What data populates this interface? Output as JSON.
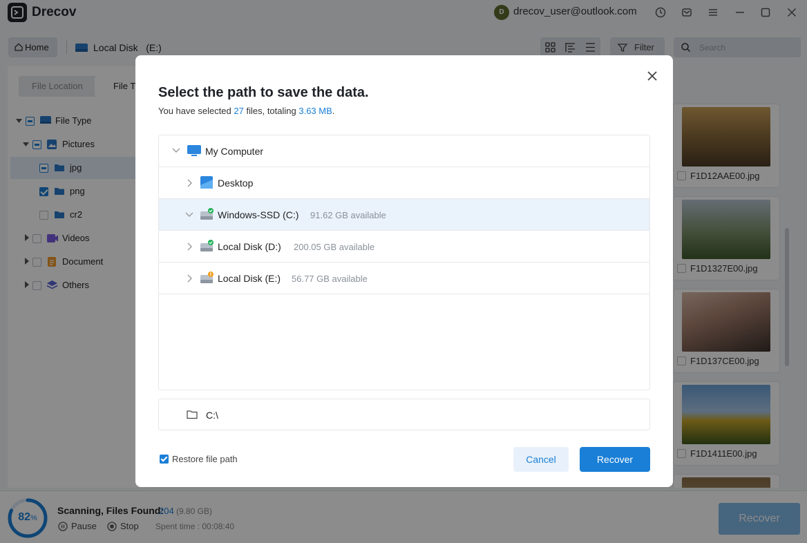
{
  "app": {
    "name": "Drecov",
    "user_email": "drecov_user@outlook.com",
    "avatar_initial": "D"
  },
  "toolbar": {
    "home_label": "Home",
    "location": "Local Disk   (E:)",
    "filter_label": "Filter",
    "search_placeholder": "Search"
  },
  "left_panel": {
    "tabs": [
      {
        "label": "File Location"
      },
      {
        "label": "File Type"
      }
    ],
    "tree": [
      {
        "label": "File Type",
        "state": "partial"
      },
      {
        "label": "Pictures",
        "state": "partial"
      },
      {
        "label": "jpg",
        "state": "partial"
      },
      {
        "label": "png",
        "state": "checked"
      },
      {
        "label": "cr2",
        "state": "unchecked"
      },
      {
        "label": "Videos",
        "state": "unchecked"
      },
      {
        "label": "Document",
        "state": "unchecked"
      },
      {
        "label": "Others",
        "state": "unchecked"
      }
    ]
  },
  "thumbnails": [
    {
      "name": "F1D12AAE00.jpg"
    },
    {
      "name": "F1D1327E00.jpg"
    },
    {
      "name": "F1D137CE00.jpg"
    },
    {
      "name": "F1D1411E00.jpg"
    }
  ],
  "scan": {
    "progress": 82,
    "progress_text": "82",
    "progress_unit": "%",
    "title": "Scanning, Files Found:",
    "count": "204",
    "size": "(9.80 GB)",
    "pause_label": "Pause",
    "stop_label": "Stop",
    "spent_time": "Spent time : 00:08:40",
    "recover_label": "Recover"
  },
  "dialog": {
    "title": "Select the path to save the data.",
    "sub_prefix": "You have selected ",
    "sub_files": "27",
    "sub_middle": " files, totaling ",
    "sub_size": "3.63 MB",
    "sub_suffix": ".",
    "tree": {
      "root": "My Computer",
      "items": [
        {
          "name": "Desktop",
          "available": ""
        },
        {
          "name": "Windows-SSD (C:)",
          "available": "91.62 GB available"
        },
        {
          "name": "Local Disk (D:)",
          "available": "200.05 GB available"
        },
        {
          "name": "Local Disk (E:)",
          "available": "56.77 GB available"
        }
      ]
    },
    "path": "C:\\",
    "restore_label": "Restore file path",
    "cancel_label": "Cancel",
    "recover_label": "Recover"
  },
  "colors": {
    "accent": "#1a7fd6",
    "dark": "#1f2329"
  }
}
